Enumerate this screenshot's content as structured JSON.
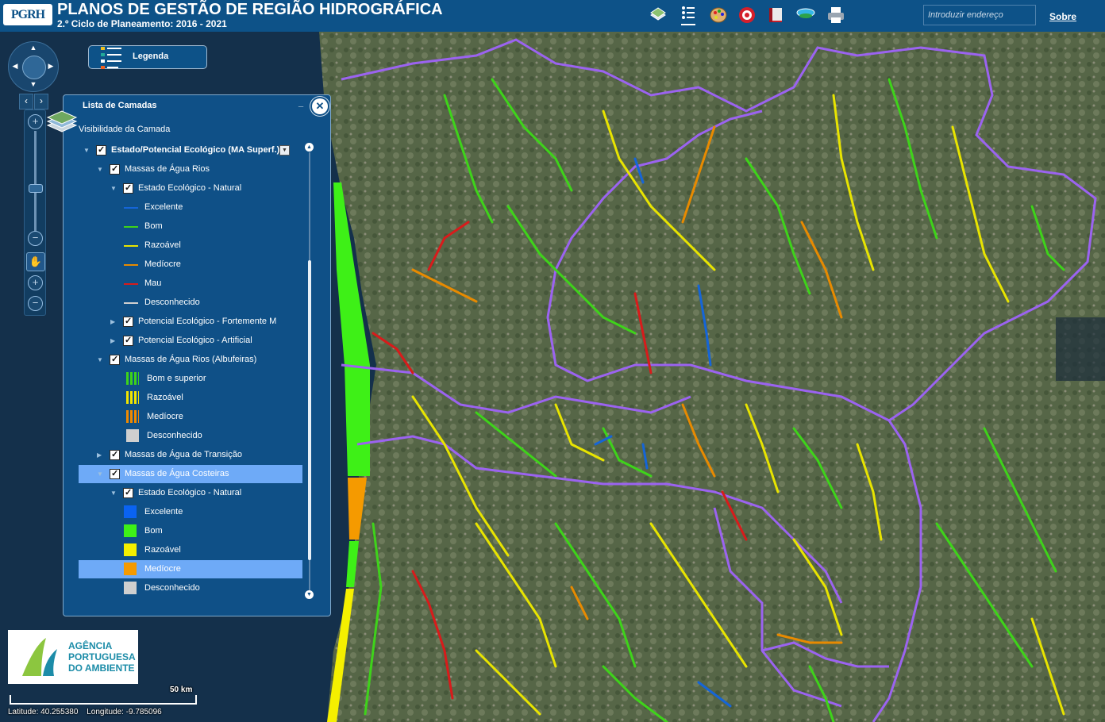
{
  "header": {
    "logo": "PGRH",
    "title": "PLANOS DE GESTÃO DE REGIÃO HIDROGRÁFICA",
    "subtitle": "2.º Ciclo de Planeamento: 2016 - 2021",
    "tools": [
      "basemap-icon",
      "list-icon",
      "palette-icon",
      "target-icon",
      "book-icon",
      "layers-icon",
      "print-icon"
    ],
    "search_placeholder": "Introduzir endereço",
    "about": "Sobre"
  },
  "legend_button": {
    "label": "Legenda"
  },
  "layer_panel": {
    "title": "Lista de Camadas",
    "minimize": "_",
    "close": "✕",
    "subtitle": "Visibilidade da Camada",
    "items": [
      {
        "label": "Estado/Potencial Ecológico (MA Superf.)",
        "level": 0,
        "type": "group",
        "checked": true,
        "bold": true
      },
      {
        "label": "Massas de Água Rios",
        "level": 1,
        "type": "group",
        "checked": true
      },
      {
        "label": "Estado Ecológico - Natural",
        "level": 2,
        "type": "group",
        "checked": true
      },
      {
        "label": "Excelente",
        "level": 3,
        "type": "line",
        "color": "#1565d8"
      },
      {
        "label": "Bom",
        "level": 3,
        "type": "line",
        "color": "#3ed31a"
      },
      {
        "label": "Razoável",
        "level": 3,
        "type": "line",
        "color": "#e8e400"
      },
      {
        "label": "Medíocre",
        "level": 3,
        "type": "line",
        "color": "#e88a00"
      },
      {
        "label": "Mau",
        "level": 3,
        "type": "line",
        "color": "#d81b1b"
      },
      {
        "label": "Desconhecido",
        "level": 3,
        "type": "line",
        "color": "#d0d0d0"
      },
      {
        "label": "Potencial Ecológico - Fortemente M",
        "level": 2,
        "type": "group",
        "checked": true,
        "collapsed": true
      },
      {
        "label": "Potencial Ecológico - Artificial",
        "level": 2,
        "type": "group",
        "checked": true,
        "collapsed": true
      },
      {
        "label": "Massas de Água Rios (Albufeiras)",
        "level": 1,
        "type": "group",
        "checked": true
      },
      {
        "label": "Bom e superior",
        "level": 2,
        "type": "hatch",
        "color": "#3ed31a"
      },
      {
        "label": "Razoável",
        "level": 2,
        "type": "hatch",
        "color": "#f2e500"
      },
      {
        "label": "Medíocre",
        "level": 2,
        "type": "hatch",
        "color": "#f08a00"
      },
      {
        "label": "Desconhecido",
        "level": 2,
        "type": "box",
        "color": "#cfcfcf"
      },
      {
        "label": "Massas de Água de Transição",
        "level": 1,
        "type": "group",
        "checked": true,
        "collapsed": true
      },
      {
        "label": "Massas de Água Costeiras",
        "level": 1,
        "type": "group",
        "checked": true,
        "selected": true
      },
      {
        "label": "Estado Ecológico - Natural",
        "level": 2,
        "type": "group",
        "checked": true
      },
      {
        "label": "Excelente",
        "level": 3,
        "type": "box",
        "color": "#0a63f2"
      },
      {
        "label": "Bom",
        "level": 3,
        "type": "box",
        "color": "#3ef017"
      },
      {
        "label": "Razoável",
        "level": 3,
        "type": "box",
        "color": "#f5f000"
      },
      {
        "label": "Medíocre",
        "level": 3,
        "type": "box",
        "color": "#f59a00",
        "selected": true
      },
      {
        "label": "Desconhecido",
        "level": 3,
        "type": "box",
        "color": "#cfcfcf"
      }
    ]
  },
  "logo_block": {
    "line1": "AGÊNCIA",
    "line2": "PORTUGUESA",
    "line3": "DO AMBIENTE"
  },
  "scale": {
    "label": "50 km"
  },
  "coordinates": {
    "latitude": "Latitude: 40.255380",
    "longitude": "Longitude: -9.785096"
  },
  "map": {
    "ocean_color": "#14304b",
    "land_color": "#4a5a38",
    "boundary_color": "#9b63f0"
  }
}
